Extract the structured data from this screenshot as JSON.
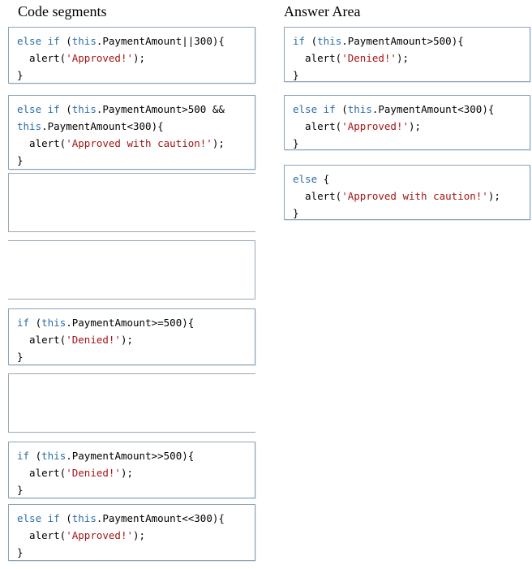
{
  "headings": {
    "segments": "Code segments",
    "answer": "Answer Area"
  },
  "segments": [
    {
      "lines": [
        [
          {
            "k": "kw",
            "t": "else if"
          },
          {
            "k": "pl",
            "t": " ("
          },
          {
            "k": "kw",
            "t": "this"
          },
          {
            "k": "pl",
            "t": ".PaymentAmount||300){"
          }
        ],
        [
          {
            "k": "pl",
            "t": "  alert("
          },
          {
            "k": "str",
            "t": "'Approved!'"
          },
          {
            "k": "pl",
            "t": ");"
          }
        ],
        [
          {
            "k": "pl",
            "t": "}"
          }
        ]
      ]
    },
    {
      "lines": [
        [
          {
            "k": "kw",
            "t": "else if"
          },
          {
            "k": "pl",
            "t": " ("
          },
          {
            "k": "kw",
            "t": "this"
          },
          {
            "k": "pl",
            "t": ".PaymentAmount>500 &&"
          }
        ],
        [
          {
            "k": "kw",
            "t": "this"
          },
          {
            "k": "pl",
            "t": ".PaymentAmount<300){"
          }
        ],
        [
          {
            "k": "pl",
            "t": "  alert("
          },
          {
            "k": "str",
            "t": "'Approved with caution!'"
          },
          {
            "k": "pl",
            "t": ");"
          }
        ],
        [
          {
            "k": "pl",
            "t": "}"
          }
        ]
      ]
    },
    {
      "lines": []
    },
    {
      "lines": []
    },
    {
      "lines": [
        [
          {
            "k": "kw",
            "t": "if"
          },
          {
            "k": "pl",
            "t": " ("
          },
          {
            "k": "kw",
            "t": "this"
          },
          {
            "k": "pl",
            "t": ".PaymentAmount>=500){"
          }
        ],
        [
          {
            "k": "pl",
            "t": "  alert("
          },
          {
            "k": "str",
            "t": "'Denied!'"
          },
          {
            "k": "pl",
            "t": ");"
          }
        ],
        [
          {
            "k": "pl",
            "t": "}"
          }
        ]
      ]
    },
    {
      "lines": []
    },
    {
      "lines": [
        [
          {
            "k": "kw",
            "t": "if"
          },
          {
            "k": "pl",
            "t": " ("
          },
          {
            "k": "kw",
            "t": "this"
          },
          {
            "k": "pl",
            "t": ".PaymentAmount>>500){"
          }
        ],
        [
          {
            "k": "pl",
            "t": "  alert("
          },
          {
            "k": "str",
            "t": "'Denied!'"
          },
          {
            "k": "pl",
            "t": ");"
          }
        ],
        [
          {
            "k": "pl",
            "t": "}"
          }
        ]
      ]
    },
    {
      "lines": [
        [
          {
            "k": "kw",
            "t": "else if"
          },
          {
            "k": "pl",
            "t": " ("
          },
          {
            "k": "kw",
            "t": "this"
          },
          {
            "k": "pl",
            "t": ".PaymentAmount<<300){"
          }
        ],
        [
          {
            "k": "pl",
            "t": "  alert("
          },
          {
            "k": "str",
            "t": "'Approved!'"
          },
          {
            "k": "pl",
            "t": ");"
          }
        ],
        [
          {
            "k": "pl",
            "t": "}"
          }
        ]
      ]
    }
  ],
  "answers": [
    {
      "lines": [
        [
          {
            "k": "kw",
            "t": "if"
          },
          {
            "k": "pl",
            "t": " ("
          },
          {
            "k": "kw",
            "t": "this"
          },
          {
            "k": "pl",
            "t": ".PaymentAmount>500){"
          }
        ],
        [
          {
            "k": "pl",
            "t": "  alert("
          },
          {
            "k": "str",
            "t": "'Denied!'"
          },
          {
            "k": "pl",
            "t": ");"
          }
        ],
        [
          {
            "k": "pl",
            "t": "}"
          }
        ]
      ]
    },
    {
      "lines": [
        [
          {
            "k": "kw",
            "t": "else if"
          },
          {
            "k": "pl",
            "t": " ("
          },
          {
            "k": "kw",
            "t": "this"
          },
          {
            "k": "pl",
            "t": ".PaymentAmount<300){"
          }
        ],
        [
          {
            "k": "pl",
            "t": "  alert("
          },
          {
            "k": "str",
            "t": "'Approved!'"
          },
          {
            "k": "pl",
            "t": ");"
          }
        ],
        [
          {
            "k": "pl",
            "t": "}"
          }
        ]
      ]
    },
    {
      "lines": [
        [
          {
            "k": "kw",
            "t": "else"
          },
          {
            "k": "pl",
            "t": " {"
          }
        ],
        [
          {
            "k": "pl",
            "t": "  alert("
          },
          {
            "k": "str",
            "t": "'Approved with caution!'"
          },
          {
            "k": "pl",
            "t": ");"
          }
        ],
        [
          {
            "k": "pl",
            "t": "}"
          }
        ]
      ]
    }
  ],
  "colors": {
    "keyword": "#2a6ea9",
    "string": "#a31515",
    "border": "#8ca4b8"
  }
}
